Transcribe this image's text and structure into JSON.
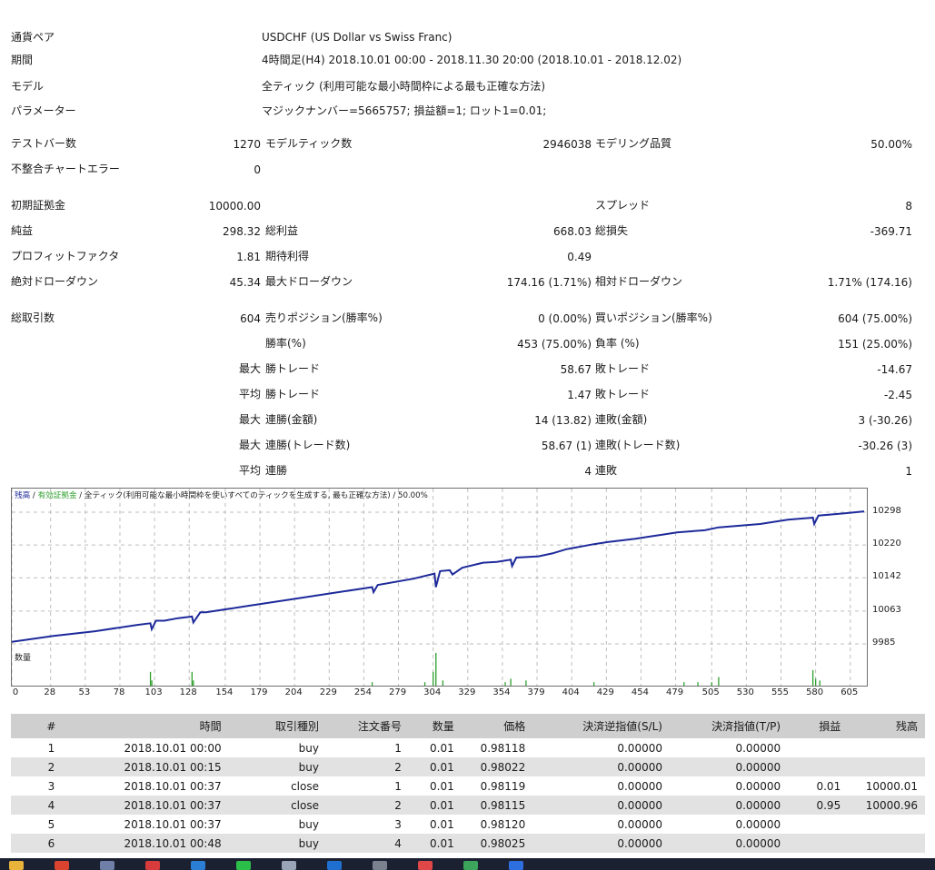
{
  "info": [
    {
      "label": "通貨ペア",
      "value": "USDCHF (US Dollar vs Swiss Franc)"
    },
    {
      "label": "期間",
      "value": "4時間足(H4) 2018.10.01 00:00 - 2018.11.30 20:00 (2018.10.01 - 2018.12.02)"
    },
    {
      "label": "モデル",
      "value": "全ティック (利用可能な最小時間枠による最も正確な方法)"
    },
    {
      "label": "パラメーター",
      "value": "マジックナンバー=5665757; 損益額=1; ロット1=0.01;"
    }
  ],
  "stats": {
    "bars_label": "テストバー数",
    "bars_value": "1270",
    "ticks_label": "モデルティック数",
    "ticks_value": "2946038",
    "quality_label": "モデリング品質",
    "quality_value": "50.00%",
    "mismatch_label": "不整合チャートエラー",
    "mismatch_value": "0",
    "deposit_label": "初期証拠金",
    "deposit_value": "10000.00",
    "spread_label": "スプレッド",
    "spread_value": "8",
    "netprofit_label": "純益",
    "netprofit_value": "298.32",
    "grossprofit_label": "総利益",
    "grossprofit_value": "668.03",
    "grossloss_label": "総損失",
    "grossloss_value": "-369.71",
    "pf_label": "プロフィットファクタ",
    "pf_value": "1.81",
    "expected_label": "期待利得",
    "expected_value": "0.49",
    "absdd_label": "絶対ドローダウン",
    "absdd_value": "45.34",
    "maxdd_label": "最大ドローダウン",
    "maxdd_value": "174.16 (1.71%)",
    "reldd_label": "相対ドローダウン",
    "reldd_value": "1.71% (174.16)",
    "trades_label": "総取引数",
    "trades_value": "604",
    "short_label": "売りポジション(勝率%)",
    "short_value": "0 (0.00%)",
    "long_label": "買いポジション(勝率%)",
    "long_value": "604 (75.00%)",
    "winrate_label": "勝率(%)",
    "winrate_value": "453 (75.00%)",
    "lossrate_label": "負率 (%)",
    "lossrate_value": "151 (25.00%)",
    "max_prefix": "最大",
    "avg_prefix": "平均",
    "largest_win_label": "勝トレード",
    "largest_win_value": "58.67",
    "largest_loss_label": "敗トレード",
    "largest_loss_value": "-14.67",
    "avg_win_label": "勝トレード",
    "avg_win_value": "1.47",
    "avg_loss_label": "敗トレード",
    "avg_loss_value": "-2.45",
    "maxconswins_label": "連勝(金額)",
    "maxconswins_value": "14 (13.82)",
    "maxconsloss_label": "連敗(金額)",
    "maxconsloss_value": "3 (-30.26)",
    "maxconsprofit_label": "連勝(トレード数)",
    "maxconsprofit_value": "58.67 (1)",
    "maxconslossnum_label": "連敗(トレード数)",
    "maxconslossnum_value": "-30.26 (3)",
    "avgconswins_label": "連勝",
    "avgconswins_value": "4",
    "avgconsloss_label": "連敗",
    "avgconsloss_value": "1"
  },
  "chart": {
    "caption_balance": "残高",
    "caption_sep1": " / ",
    "caption_equity": "有効証拠金",
    "caption_rest": " / 全ティック(利用可能な最小時間枠を使いすべてのティックを生成する, 最も正確な方法) / 50.00%",
    "volume_title": "数量",
    "colors": {
      "balance": "#1e2a9a",
      "equity": "#2ea02e",
      "volume": "#2ea02e",
      "grid": "#bdbdbd"
    }
  },
  "chart_data": {
    "type": "line",
    "yticks": [
      "10298",
      "10220",
      "10142",
      "10063",
      "9985"
    ],
    "ylim": [
      9985,
      10298
    ],
    "xlim": [
      0,
      615
    ],
    "xticks": [
      "0",
      "28",
      "53",
      "78",
      "103",
      "128",
      "154",
      "179",
      "204",
      "229",
      "254",
      "279",
      "304",
      "329",
      "354",
      "379",
      "404",
      "429",
      "454",
      "479",
      "505",
      "530",
      "555",
      "580",
      "605"
    ],
    "series": [
      {
        "x": [
          0,
          30,
          60,
          90,
          100,
          101,
          104,
          110,
          120,
          130,
          131,
          136,
          140,
          170,
          200,
          230,
          260,
          261,
          264,
          290,
          305,
          306,
          309,
          316,
          318,
          325,
          340,
          350,
          360,
          361,
          364,
          380,
          390,
          400,
          420,
          430,
          450,
          460,
          470,
          480,
          500,
          510,
          540,
          560,
          578,
          579,
          582,
          600,
          615
        ],
        "y": [
          9990,
          10004,
          10015,
          10030,
          10034,
          10020,
          10040,
          10040,
          10046,
          10050,
          10036,
          10060,
          10060,
          10075,
          10090,
          10105,
          10120,
          10108,
          10125,
          10140,
          10152,
          10120,
          10158,
          10160,
          10150,
          10166,
          10178,
          10180,
          10185,
          10170,
          10190,
          10193,
          10200,
          10210,
          10222,
          10227,
          10235,
          10240,
          10245,
          10250,
          10255,
          10262,
          10270,
          10280,
          10285,
          10270,
          10290,
          10295,
          10300
        ]
      }
    ],
    "volume_bars": [
      {
        "x": 100,
        "v": 0.4
      },
      {
        "x": 101,
        "v": 0.15
      },
      {
        "x": 130,
        "v": 0.4
      },
      {
        "x": 131,
        "v": 0.15
      },
      {
        "x": 260,
        "v": 0.1
      },
      {
        "x": 298,
        "v": 0.1
      },
      {
        "x": 304,
        "v": 0.4
      },
      {
        "x": 306,
        "v": 0.95
      },
      {
        "x": 311,
        "v": 0.15
      },
      {
        "x": 356,
        "v": 0.1
      },
      {
        "x": 360,
        "v": 0.2
      },
      {
        "x": 371,
        "v": 0.15
      },
      {
        "x": 420,
        "v": 0.1
      },
      {
        "x": 485,
        "v": 0.1
      },
      {
        "x": 495,
        "v": 0.1
      },
      {
        "x": 505,
        "v": 0.1
      },
      {
        "x": 510,
        "v": 0.25
      },
      {
        "x": 578,
        "v": 0.45
      },
      {
        "x": 580,
        "v": 0.2
      },
      {
        "x": 583,
        "v": 0.15
      }
    ]
  },
  "table": {
    "headers": [
      "#",
      "時間",
      "取引種別",
      "注文番号",
      "数量",
      "価格",
      "決済逆指値(S/L)",
      "決済指値(T/P)",
      "損益",
      "残高"
    ],
    "rows": [
      [
        "1",
        "2018.10.01 00:00",
        "buy",
        "1",
        "0.01",
        "0.98118",
        "0.00000",
        "0.00000",
        "",
        ""
      ],
      [
        "2",
        "2018.10.01 00:15",
        "buy",
        "2",
        "0.01",
        "0.98022",
        "0.00000",
        "0.00000",
        "",
        ""
      ],
      [
        "3",
        "2018.10.01 00:37",
        "close",
        "1",
        "0.01",
        "0.98119",
        "0.00000",
        "0.00000",
        "0.01",
        "10000.01"
      ],
      [
        "4",
        "2018.10.01 00:37",
        "close",
        "2",
        "0.01",
        "0.98115",
        "0.00000",
        "0.00000",
        "0.95",
        "10000.96"
      ],
      [
        "5",
        "2018.10.01 00:37",
        "buy",
        "3",
        "0.01",
        "0.98120",
        "0.00000",
        "0.00000",
        "",
        ""
      ],
      [
        "6",
        "2018.10.01 00:48",
        "buy",
        "4",
        "0.01",
        "0.98025",
        "0.00000",
        "0.00000",
        "",
        ""
      ]
    ]
  },
  "taskbar": {
    "icons": [
      {
        "name": "folder-icon",
        "color": "#e8b33a"
      },
      {
        "name": "chrome-icon",
        "color": "#d9432f"
      },
      {
        "name": "explorer-icon",
        "color": "#6f7fa8"
      },
      {
        "name": "app-red-icon",
        "color": "#d83b3b"
      },
      {
        "name": "app-blue-icon",
        "color": "#2a7fd4"
      },
      {
        "name": "app-green-icon",
        "color": "#2bbf4a"
      },
      {
        "name": "app-pointer-icon",
        "color": "#9aa4b8"
      },
      {
        "name": "app-blue2-icon",
        "color": "#1f6fd0"
      },
      {
        "name": "app-gray-icon",
        "color": "#7a8290"
      },
      {
        "name": "app-red2-icon",
        "color": "#e04848"
      },
      {
        "name": "app-green2-icon",
        "color": "#3ba55c"
      },
      {
        "name": "app-blue3-icon",
        "color": "#2d6ee0"
      }
    ]
  }
}
